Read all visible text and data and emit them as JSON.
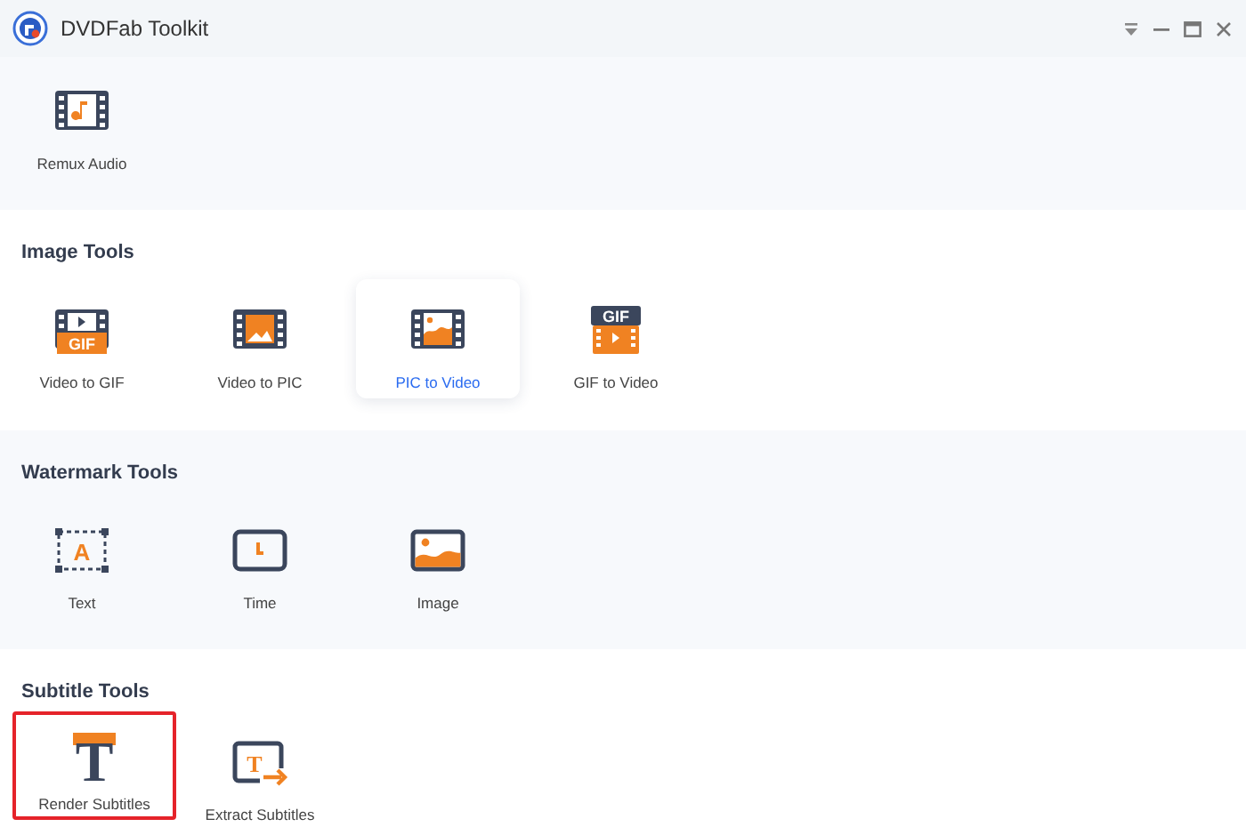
{
  "window": {
    "title": "DVDFab Toolkit"
  },
  "sections": [
    {
      "tools": [
        {
          "label": "Remux Audio",
          "selected": false,
          "highlighted": false
        }
      ]
    },
    {
      "title": "Image Tools",
      "tools": [
        {
          "label": "Video to GIF",
          "selected": false,
          "highlighted": false,
          "badge": "GIF"
        },
        {
          "label": "Video to PIC",
          "selected": false,
          "highlighted": false
        },
        {
          "label": "PIC to Video",
          "selected": true,
          "highlighted": false
        },
        {
          "label": "GIF to Video",
          "selected": false,
          "highlighted": false,
          "badge": "GIF"
        }
      ]
    },
    {
      "title": "Watermark Tools",
      "tools": [
        {
          "label": "Text",
          "selected": false,
          "highlighted": false,
          "glyph": "A"
        },
        {
          "label": "Time",
          "selected": false,
          "highlighted": false
        },
        {
          "label": "Image",
          "selected": false,
          "highlighted": false
        }
      ]
    },
    {
      "title": "Subtitle Tools",
      "tools": [
        {
          "label": "Render Subtitles",
          "selected": false,
          "highlighted": true,
          "glyph": "T"
        },
        {
          "label": "Extract Subtitles",
          "selected": false,
          "highlighted": false,
          "glyph": "T"
        }
      ]
    }
  ]
}
